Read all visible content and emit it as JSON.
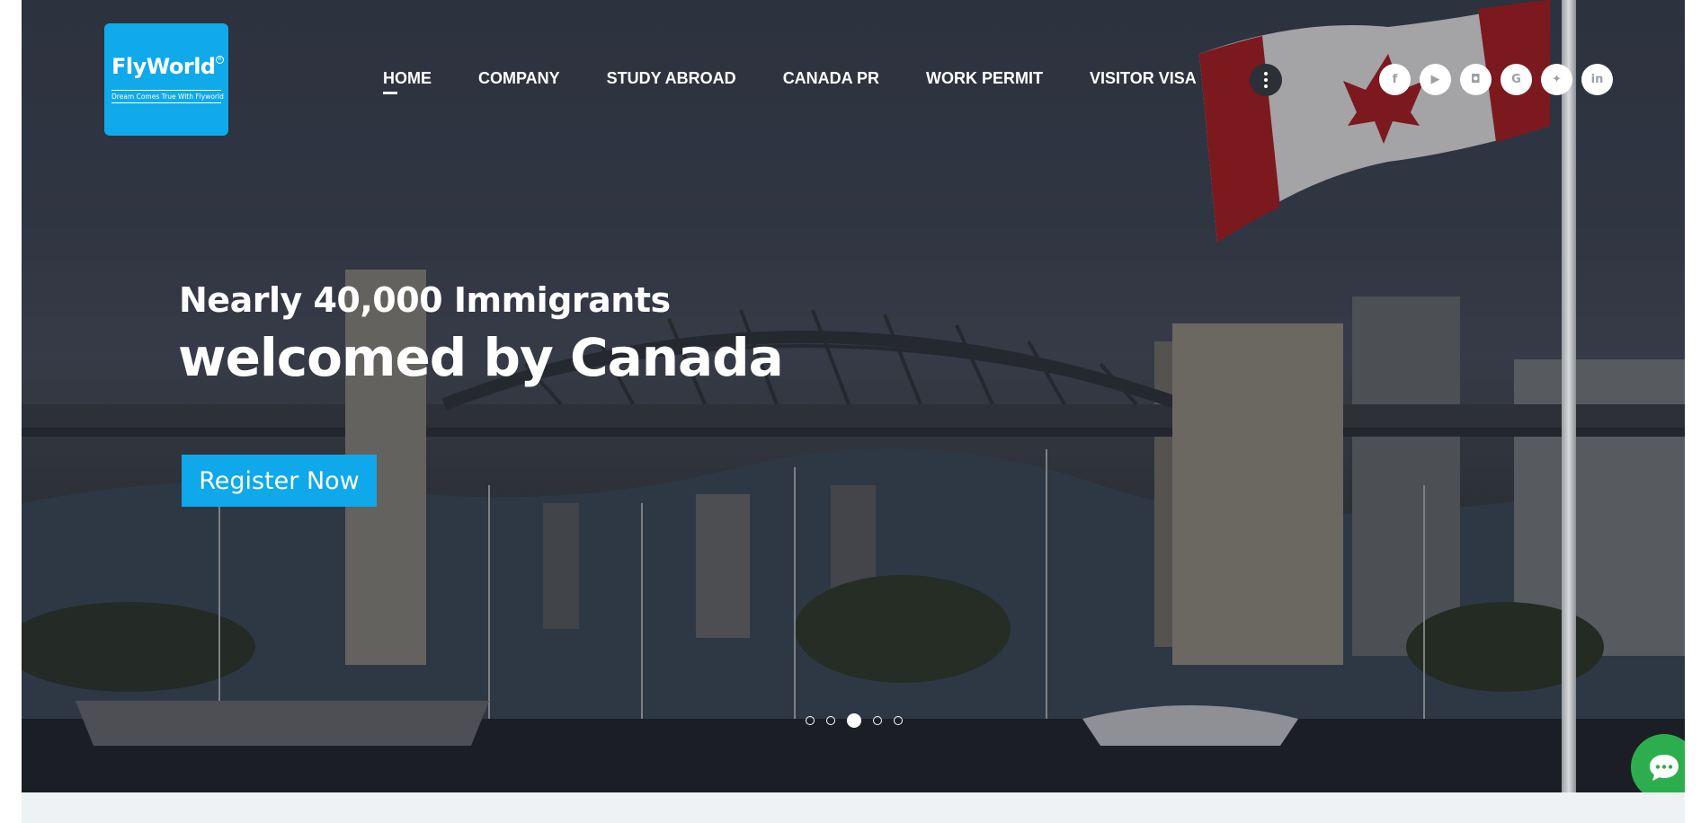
{
  "brand": {
    "name": "FlyWorld",
    "registered_mark": "R",
    "tagline": "Dream Comes True With Flyworld",
    "accent_color": "#10a9ea"
  },
  "nav": {
    "items": [
      {
        "label": "HOME",
        "active": true
      },
      {
        "label": "COMPANY",
        "active": false
      },
      {
        "label": "STUDY ABROAD",
        "active": false
      },
      {
        "label": "CANADA PR",
        "active": false
      },
      {
        "label": "WORK PERMIT",
        "active": false
      },
      {
        "label": "VISITOR VISA",
        "active": false
      }
    ],
    "more_icon": "more-vertical-icon"
  },
  "social": [
    {
      "icon": "facebook-icon",
      "glyph": "f"
    },
    {
      "icon": "youtube-icon",
      "glyph": "▶"
    },
    {
      "icon": "instagram-icon",
      "glyph": "◘"
    },
    {
      "icon": "google-icon",
      "glyph": "G"
    },
    {
      "icon": "twitter-icon",
      "glyph": "✦"
    },
    {
      "icon": "linkedin-icon",
      "glyph": "in"
    }
  ],
  "hero": {
    "title": "Nearly 40,000 Immigrants",
    "heading": "welcomed by Canada",
    "cta_label": "Register Now",
    "slides": {
      "count": 5,
      "active": 3
    }
  },
  "chat": {
    "icon": "chat-bubble-icon",
    "color": "#2cae4e"
  }
}
